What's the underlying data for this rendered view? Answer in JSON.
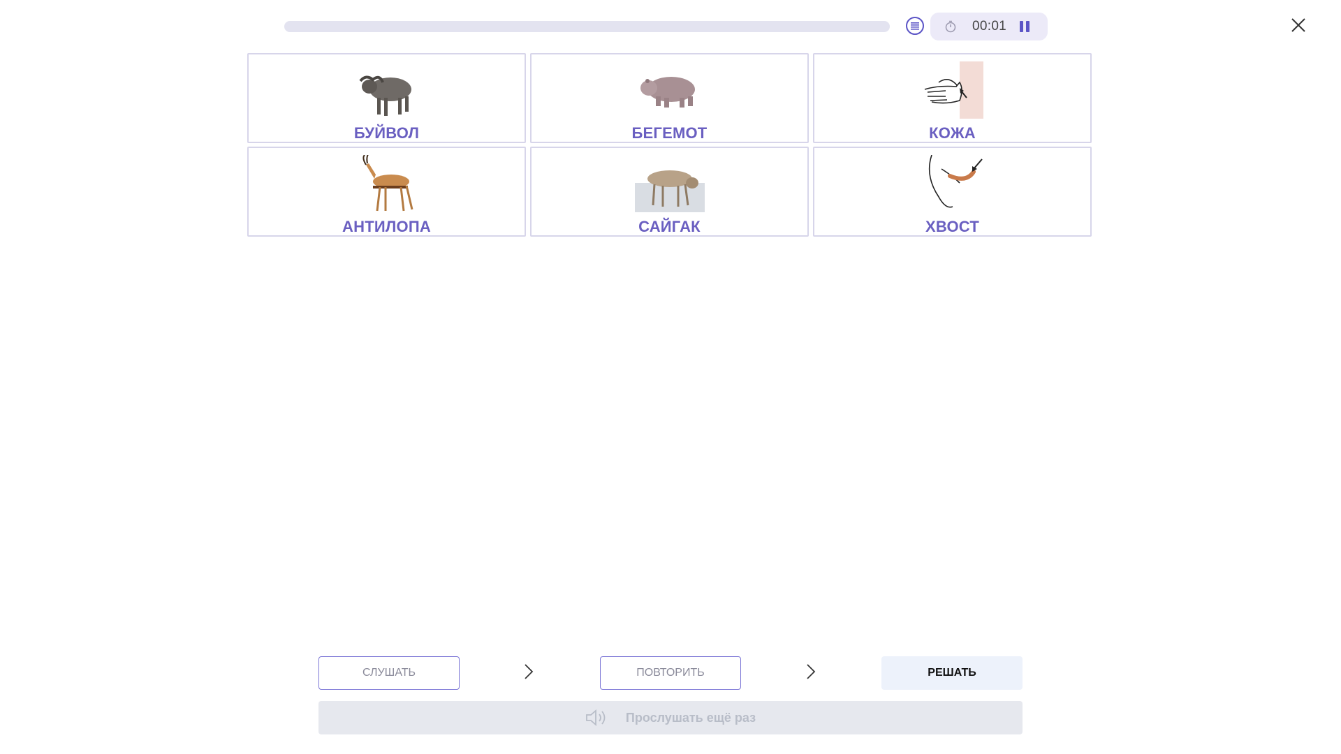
{
  "header": {
    "progress_fraction": 0,
    "timer": "00:01"
  },
  "cards": [
    {
      "label": "БУЙВОЛ",
      "icon": "buffalo-icon"
    },
    {
      "label": "БЕГЕМОТ",
      "icon": "hippo-icon"
    },
    {
      "label": "КОЖА",
      "icon": "skin-hand-icon"
    },
    {
      "label": "АНТИЛОПА",
      "icon": "antelope-icon"
    },
    {
      "label": "САЙГАК",
      "icon": "saiga-icon"
    },
    {
      "label": "ХВОСТ",
      "icon": "tail-icon"
    }
  ],
  "steps": {
    "listen_label": "СЛУШАТЬ",
    "repeat_label": "ПОВТОРИТЬ",
    "solve_label": "РЕШАТЬ"
  },
  "listen_again_label": "Прослушать ещё раз",
  "colors": {
    "accent": "#6a5fc1",
    "card_border": "#d7d5ea",
    "progress_track": "#e3e3f0",
    "timer_bg": "#eceaf8"
  }
}
